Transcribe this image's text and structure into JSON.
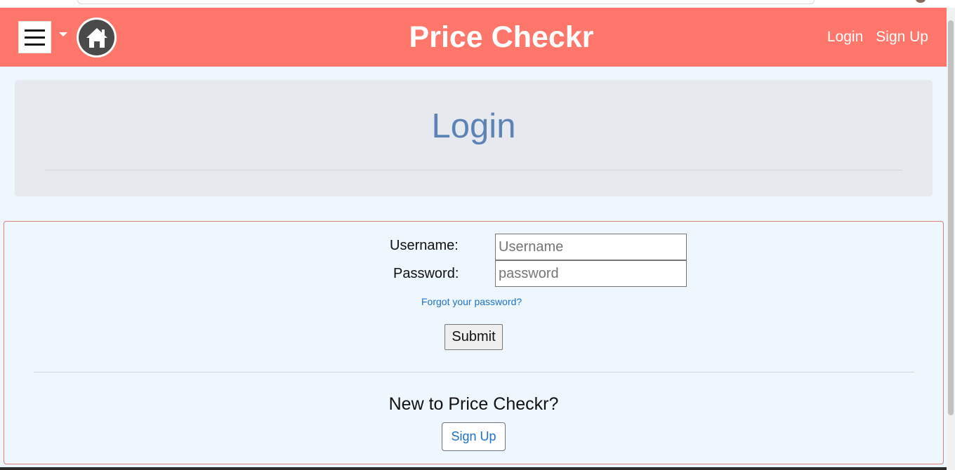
{
  "navbar": {
    "brand": "Price Checkr",
    "login_link": "Login",
    "signup_link": "Sign Up",
    "icons": [
      "hamburger-menu-icon",
      "dropdown-caret-icon",
      "home-icon"
    ],
    "background_color": "#ff776b"
  },
  "header": {
    "title": "Login",
    "title_color": "#5b83b6"
  },
  "form": {
    "username_label": "Username:",
    "username_placeholder": "Username",
    "username_value": "",
    "password_label": "Password:",
    "password_placeholder": "password",
    "password_value": "",
    "forgot_link": "Forgot your password?",
    "submit_label": "Submit",
    "new_user_prompt": "New to Price Checkr?",
    "signup_button": "Sign Up",
    "link_color": "#1a73c8"
  }
}
